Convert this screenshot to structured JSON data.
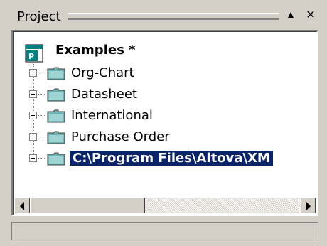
{
  "panel": {
    "title": "Project",
    "collapse_icon": "triangle-up-icon",
    "close_icon": "close-icon"
  },
  "tree": {
    "root": {
      "label": "Examples *",
      "icon": "project-icon"
    },
    "items": [
      {
        "label": "Org-Chart",
        "icon": "folder-icon",
        "selected": false
      },
      {
        "label": "Datasheet",
        "icon": "folder-icon",
        "selected": false
      },
      {
        "label": "International",
        "icon": "folder-icon",
        "selected": false
      },
      {
        "label": "Purchase Order",
        "icon": "folder-icon",
        "selected": false
      },
      {
        "label": "C:\\Program Files\\Altova\\XM",
        "icon": "folder-icon",
        "selected": true
      }
    ]
  },
  "colors": {
    "selection": "#0a246a",
    "chrome": "#d4d0c8"
  }
}
